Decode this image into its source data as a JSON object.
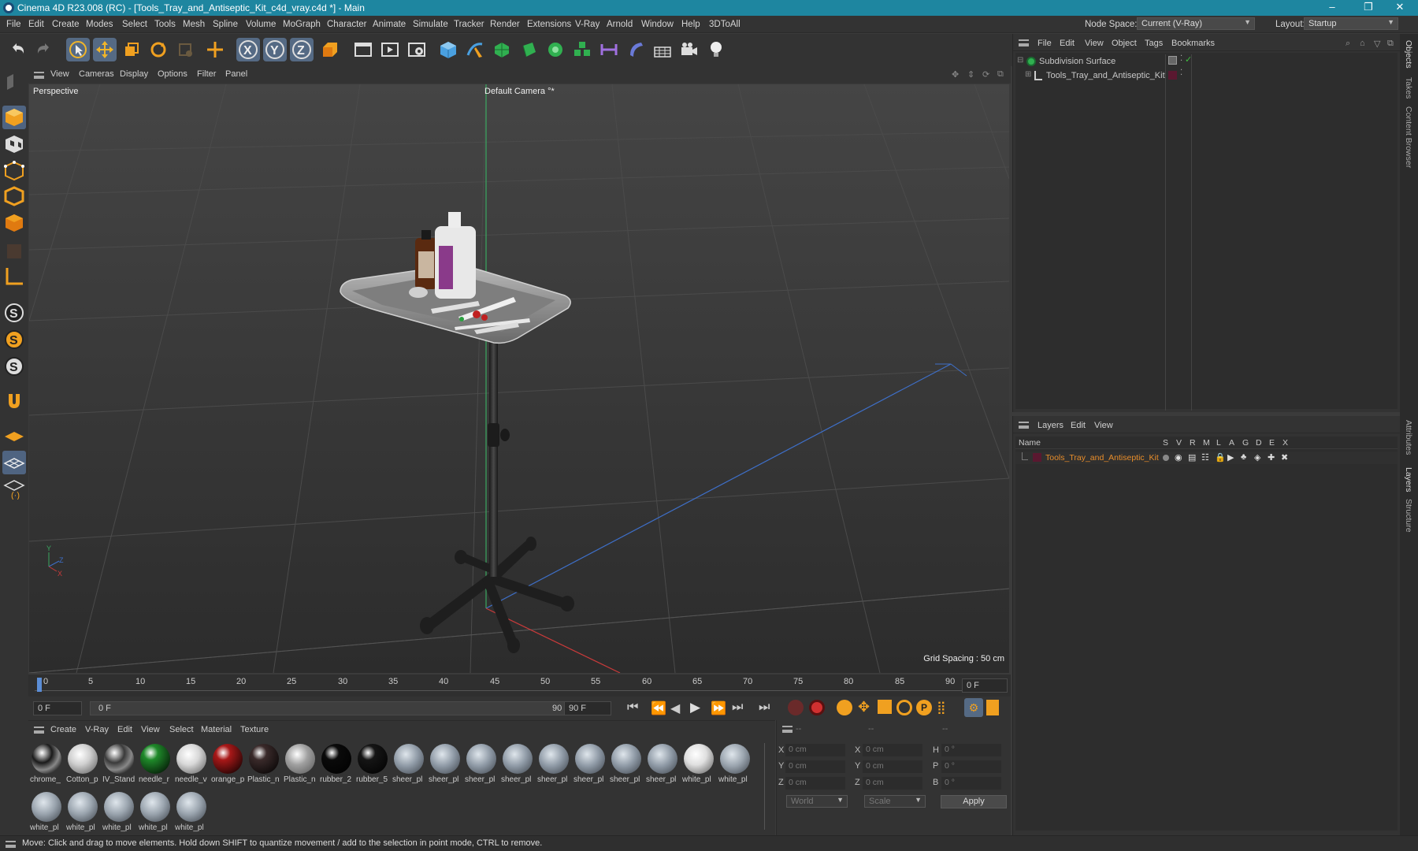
{
  "window": {
    "title": "Cinema 4D R23.008 (RC) - [Tools_Tray_and_Antiseptic_Kit_c4d_vray.c4d *] - Main",
    "minimize": "–",
    "maximize": "❐",
    "close": "✕"
  },
  "menubar": {
    "items": [
      "File",
      "Edit",
      "Create",
      "Modes",
      "Select",
      "Tools",
      "Mesh",
      "Spline",
      "Volume",
      "MoGraph",
      "Character",
      "Animate",
      "Simulate",
      "Tracker",
      "Render",
      "Extensions",
      "V-Ray",
      "Arnold",
      "Window",
      "Help",
      "3DToAll"
    ],
    "node_space_label": "Node Space:",
    "node_space_value": "Current (V-Ray)",
    "layout_label": "Layout:",
    "layout_value": "Startup"
  },
  "toolbar": {
    "icons": [
      "undo-icon",
      "redo-icon",
      "select-icon",
      "move-icon",
      "scale-icon",
      "rotate-icon",
      "scale-tool-icon",
      "move-tool-icon",
      "x-axis-icon",
      "y-axis-icon",
      "z-axis-icon",
      "coordinate-system-icon",
      "render-region-icon",
      "render-view-icon",
      "render-settings-icon",
      "cube-icon",
      "pen-icon",
      "subdivision-icon",
      "extrude-icon",
      "cloner-icon",
      "array-icon",
      "symmetry-icon",
      "deformer-icon",
      "floor-icon",
      "camera-icon",
      "light-icon"
    ],
    "axis_x": "X",
    "axis_y": "Y",
    "axis_z": "Z"
  },
  "viewport": {
    "menu": [
      "View",
      "Cameras",
      "Display",
      "Options",
      "Filter",
      "Panel"
    ],
    "label": "Perspective",
    "camera": "Default Camera °*",
    "grid_spacing": "Grid Spacing : 50 cm"
  },
  "timeline": {
    "ticks": [
      "0",
      "5",
      "10",
      "15",
      "20",
      "25",
      "30",
      "35",
      "40",
      "45",
      "50",
      "55",
      "60",
      "65",
      "70",
      "75",
      "80",
      "85",
      "90"
    ],
    "current_frame": "0 F",
    "start_frame": "0 F",
    "range_start": "0 F",
    "range_end": "90 F",
    "end_frame": "90 F"
  },
  "materials": {
    "menu": [
      "Create",
      "V-Ray",
      "Edit",
      "View",
      "Select",
      "Material",
      "Texture"
    ],
    "items": [
      {
        "label": "chrome_",
        "color": "#1a1a1a",
        "type": "chrome"
      },
      {
        "label": "Cotton_p",
        "color": "#cfcfcf",
        "type": "matte"
      },
      {
        "label": "IV_Stand",
        "color": "#3a3a3a",
        "type": "chrome"
      },
      {
        "label": "needle_r",
        "color": "#1f8a2a",
        "type": "glossy"
      },
      {
        "label": "needle_v",
        "color": "#d8d8d8",
        "type": "matte"
      },
      {
        "label": "orange_p",
        "color": "#a81818",
        "type": "glossy"
      },
      {
        "label": "Plastic_n",
        "color": "#3a2a2a",
        "type": "glossy"
      },
      {
        "label": "Plastic_n",
        "color": "#a0a0a0",
        "type": "matte"
      },
      {
        "label": "rubber_2",
        "color": "#0a0a0a",
        "type": "glossy"
      },
      {
        "label": "rubber_5",
        "color": "#151515",
        "type": "glossy"
      },
      {
        "label": "sheer_pl",
        "color": "#8f9aa6",
        "type": "sheer"
      },
      {
        "label": "sheer_pl",
        "color": "#8f9aa6",
        "type": "sheer"
      },
      {
        "label": "sheer_pl",
        "color": "#8f9aa6",
        "type": "sheer"
      },
      {
        "label": "sheer_pl",
        "color": "#8f9aa6",
        "type": "sheer"
      },
      {
        "label": "sheer_pl",
        "color": "#8f9aa6",
        "type": "sheer"
      },
      {
        "label": "sheer_pl",
        "color": "#8f9aa6",
        "type": "sheer"
      },
      {
        "label": "sheer_pl",
        "color": "#8f9aa6",
        "type": "sheer"
      },
      {
        "label": "sheer_pl",
        "color": "#8f9aa6",
        "type": "sheer"
      },
      {
        "label": "white_pl",
        "color": "#e0e0e0",
        "type": "matte"
      },
      {
        "label": "white_pl",
        "color": "#9aa4ae",
        "type": "sheer"
      },
      {
        "label": "white_pl",
        "color": "#9aa4ae",
        "type": "sheer"
      },
      {
        "label": "white_pl",
        "color": "#9aa4ae",
        "type": "sheer"
      },
      {
        "label": "white_pl",
        "color": "#9aa4ae",
        "type": "sheer"
      },
      {
        "label": "white_pl",
        "color": "#9aa4ae",
        "type": "sheer"
      },
      {
        "label": "white_pl",
        "color": "#9aa4ae",
        "type": "sheer"
      }
    ]
  },
  "coordinates": {
    "header": [
      "--",
      "--",
      "--"
    ],
    "pos_labels": [
      "X",
      "Y",
      "Z"
    ],
    "size_labels": [
      "X",
      "Y",
      "Z"
    ],
    "rot_labels": [
      "H",
      "P",
      "B"
    ],
    "pos_values": [
      "0 cm",
      "0 cm",
      "0 cm"
    ],
    "size_values": [
      "0 cm",
      "0 cm",
      "0 cm"
    ],
    "rot_values": [
      "0 °",
      "0 °",
      "0 °"
    ],
    "mode_world": "World",
    "mode_scale": "Scale",
    "apply": "Apply"
  },
  "objects": {
    "menu": [
      "File",
      "Edit",
      "View",
      "Object",
      "Tags",
      "Bookmarks"
    ],
    "tree": [
      {
        "name": "Subdivision Surface",
        "color": "#d8d8d8",
        "indent": 0
      },
      {
        "name": "Tools_Tray_and_Antiseptic_Kit",
        "color": "#d8d8d8",
        "indent": 1
      }
    ]
  },
  "layers": {
    "menu": [
      "Layers",
      "Edit",
      "View"
    ],
    "columns": [
      "Name",
      "S",
      "V",
      "R",
      "M",
      "L",
      "A",
      "G",
      "D",
      "E",
      "X"
    ],
    "rows": [
      {
        "name": "Tools_Tray_and_Antiseptic_Kit",
        "color": "#e88d2a",
        "swatch": "#5a1830"
      }
    ]
  },
  "side_tabs": [
    "Objects",
    "Takes",
    "Content Browser",
    "Attributes",
    "Layers",
    "Structure"
  ],
  "status": {
    "text": "Move: Click and drag to move elements. Hold down SHIFT to quantize movement / add to the selection in point mode, CTRL to remove."
  },
  "colors": {
    "accent": "#1e86a0",
    "active_tool": "#556a84",
    "timeline_marker": "#5b8dd6"
  }
}
